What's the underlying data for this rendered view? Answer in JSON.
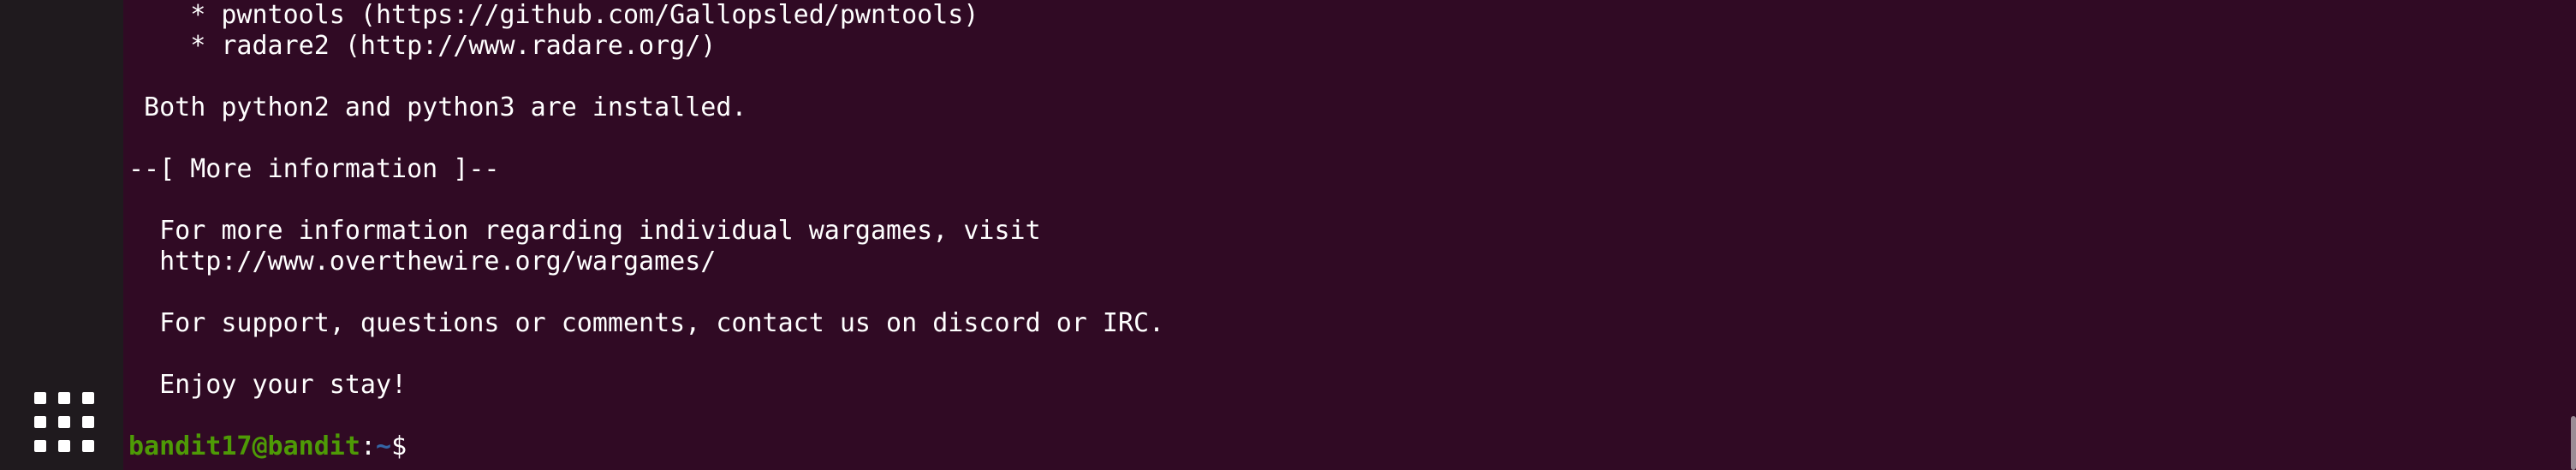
{
  "dock": {
    "apps_icon": "grid-icon"
  },
  "terminal": {
    "lines": [
      "    * pwntools (https://github.com/Gallopsled/pwntools)",
      "    * radare2 (http://www.radare.org/)",
      "",
      " Both python2 and python3 are installed.",
      "",
      "--[ More information ]--",
      "",
      "  For more information regarding individual wargames, visit",
      "  http://www.overthewire.org/wargames/",
      "",
      "  For support, questions or comments, contact us on discord or IRC.",
      "",
      "  Enjoy your stay!",
      ""
    ],
    "prompt": {
      "user_host": "bandit17@bandit",
      "separator": ":",
      "path": "~",
      "symbol": "$"
    }
  },
  "colors": {
    "background": "#300a24",
    "prompt_user": "#4e9a06",
    "prompt_path": "#3465a4",
    "text": "#ffffff"
  }
}
